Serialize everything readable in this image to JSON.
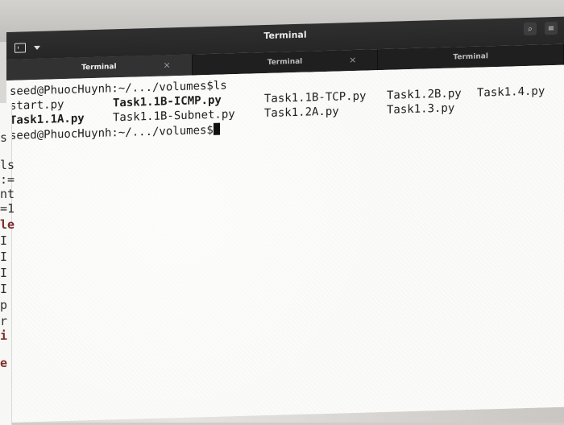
{
  "window": {
    "title": "Terminal"
  },
  "tabs": [
    {
      "label": "Terminal",
      "close": "×"
    },
    {
      "label": "Terminal",
      "close": "×"
    },
    {
      "label": "Terminal",
      "close": ""
    }
  ],
  "terminal": {
    "line1": "seed@PhuocHuynh:~/.../volumes$ls",
    "files": [
      {
        "name": "start.py",
        "color": "#1e1e1e"
      },
      {
        "name": "Task1.1B-ICMP.py",
        "color": "#3c8f2e"
      },
      {
        "name": "Task1.1B-TCP.py",
        "color": "#1e1e1e"
      },
      {
        "name": "Task1.2B.py",
        "color": "#1e1e1e"
      },
      {
        "name": "Task1.4.py",
        "color": "#1e1e1e"
      },
      {
        "name": "Task1.1A.py",
        "color": "#3c8f2e"
      },
      {
        "name": "Task1.1B-Subnet.py",
        "color": "#1e1e1e"
      },
      {
        "name": "Task1.2A.py",
        "color": "#1e1e1e"
      },
      {
        "name": "Task1.3.py",
        "color": "#1e1e1e"
      }
    ],
    "prompt": "seed@PhuocHuynh:~/.../volumes$"
  },
  "behind": {
    "chars": [
      "s",
      "ls",
      ":=",
      "nt",
      "=1",
      "le",
      "I",
      "I",
      "I",
      "I",
      "p",
      "r",
      "i",
      "e"
    ]
  },
  "icons": [
    "terminal-icon",
    "chevron-down-icon",
    "search-icon",
    "menu-icon"
  ]
}
